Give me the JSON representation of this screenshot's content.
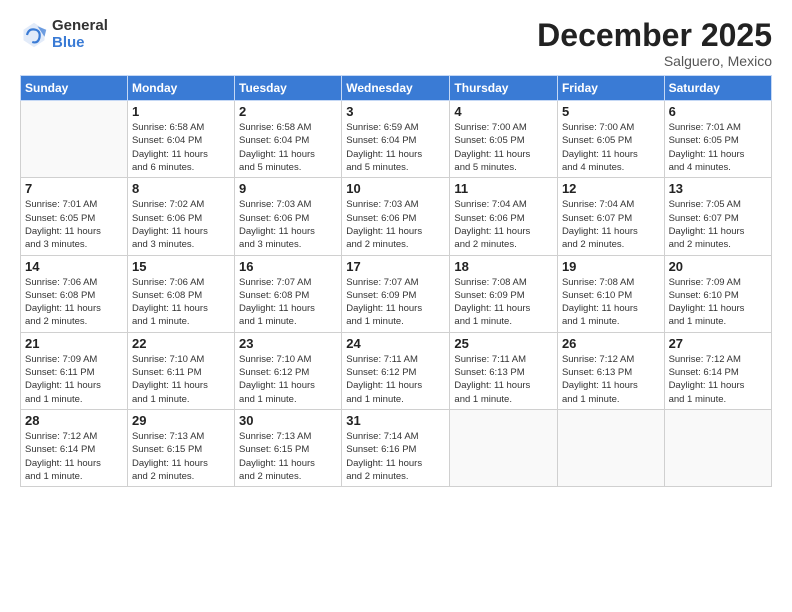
{
  "logo": {
    "general": "General",
    "blue": "Blue"
  },
  "title": "December 2025",
  "subtitle": "Salguero, Mexico",
  "days_of_week": [
    "Sunday",
    "Monday",
    "Tuesday",
    "Wednesday",
    "Thursday",
    "Friday",
    "Saturday"
  ],
  "weeks": [
    [
      {
        "day": "",
        "info": ""
      },
      {
        "day": "1",
        "info": "Sunrise: 6:58 AM\nSunset: 6:04 PM\nDaylight: 11 hours\nand 6 minutes."
      },
      {
        "day": "2",
        "info": "Sunrise: 6:58 AM\nSunset: 6:04 PM\nDaylight: 11 hours\nand 5 minutes."
      },
      {
        "day": "3",
        "info": "Sunrise: 6:59 AM\nSunset: 6:04 PM\nDaylight: 11 hours\nand 5 minutes."
      },
      {
        "day": "4",
        "info": "Sunrise: 7:00 AM\nSunset: 6:05 PM\nDaylight: 11 hours\nand 5 minutes."
      },
      {
        "day": "5",
        "info": "Sunrise: 7:00 AM\nSunset: 6:05 PM\nDaylight: 11 hours\nand 4 minutes."
      },
      {
        "day": "6",
        "info": "Sunrise: 7:01 AM\nSunset: 6:05 PM\nDaylight: 11 hours\nand 4 minutes."
      }
    ],
    [
      {
        "day": "7",
        "info": "Sunrise: 7:01 AM\nSunset: 6:05 PM\nDaylight: 11 hours\nand 3 minutes."
      },
      {
        "day": "8",
        "info": "Sunrise: 7:02 AM\nSunset: 6:06 PM\nDaylight: 11 hours\nand 3 minutes."
      },
      {
        "day": "9",
        "info": "Sunrise: 7:03 AM\nSunset: 6:06 PM\nDaylight: 11 hours\nand 3 minutes."
      },
      {
        "day": "10",
        "info": "Sunrise: 7:03 AM\nSunset: 6:06 PM\nDaylight: 11 hours\nand 2 minutes."
      },
      {
        "day": "11",
        "info": "Sunrise: 7:04 AM\nSunset: 6:06 PM\nDaylight: 11 hours\nand 2 minutes."
      },
      {
        "day": "12",
        "info": "Sunrise: 7:04 AM\nSunset: 6:07 PM\nDaylight: 11 hours\nand 2 minutes."
      },
      {
        "day": "13",
        "info": "Sunrise: 7:05 AM\nSunset: 6:07 PM\nDaylight: 11 hours\nand 2 minutes."
      }
    ],
    [
      {
        "day": "14",
        "info": "Sunrise: 7:06 AM\nSunset: 6:08 PM\nDaylight: 11 hours\nand 2 minutes."
      },
      {
        "day": "15",
        "info": "Sunrise: 7:06 AM\nSunset: 6:08 PM\nDaylight: 11 hours\nand 1 minute."
      },
      {
        "day": "16",
        "info": "Sunrise: 7:07 AM\nSunset: 6:08 PM\nDaylight: 11 hours\nand 1 minute."
      },
      {
        "day": "17",
        "info": "Sunrise: 7:07 AM\nSunset: 6:09 PM\nDaylight: 11 hours\nand 1 minute."
      },
      {
        "day": "18",
        "info": "Sunrise: 7:08 AM\nSunset: 6:09 PM\nDaylight: 11 hours\nand 1 minute."
      },
      {
        "day": "19",
        "info": "Sunrise: 7:08 AM\nSunset: 6:10 PM\nDaylight: 11 hours\nand 1 minute."
      },
      {
        "day": "20",
        "info": "Sunrise: 7:09 AM\nSunset: 6:10 PM\nDaylight: 11 hours\nand 1 minute."
      }
    ],
    [
      {
        "day": "21",
        "info": "Sunrise: 7:09 AM\nSunset: 6:11 PM\nDaylight: 11 hours\nand 1 minute."
      },
      {
        "day": "22",
        "info": "Sunrise: 7:10 AM\nSunset: 6:11 PM\nDaylight: 11 hours\nand 1 minute."
      },
      {
        "day": "23",
        "info": "Sunrise: 7:10 AM\nSunset: 6:12 PM\nDaylight: 11 hours\nand 1 minute."
      },
      {
        "day": "24",
        "info": "Sunrise: 7:11 AM\nSunset: 6:12 PM\nDaylight: 11 hours\nand 1 minute."
      },
      {
        "day": "25",
        "info": "Sunrise: 7:11 AM\nSunset: 6:13 PM\nDaylight: 11 hours\nand 1 minute."
      },
      {
        "day": "26",
        "info": "Sunrise: 7:12 AM\nSunset: 6:13 PM\nDaylight: 11 hours\nand 1 minute."
      },
      {
        "day": "27",
        "info": "Sunrise: 7:12 AM\nSunset: 6:14 PM\nDaylight: 11 hours\nand 1 minute."
      }
    ],
    [
      {
        "day": "28",
        "info": "Sunrise: 7:12 AM\nSunset: 6:14 PM\nDaylight: 11 hours\nand 1 minute."
      },
      {
        "day": "29",
        "info": "Sunrise: 7:13 AM\nSunset: 6:15 PM\nDaylight: 11 hours\nand 2 minutes."
      },
      {
        "day": "30",
        "info": "Sunrise: 7:13 AM\nSunset: 6:15 PM\nDaylight: 11 hours\nand 2 minutes."
      },
      {
        "day": "31",
        "info": "Sunrise: 7:14 AM\nSunset: 6:16 PM\nDaylight: 11 hours\nand 2 minutes."
      },
      {
        "day": "",
        "info": ""
      },
      {
        "day": "",
        "info": ""
      },
      {
        "day": "",
        "info": ""
      }
    ]
  ]
}
